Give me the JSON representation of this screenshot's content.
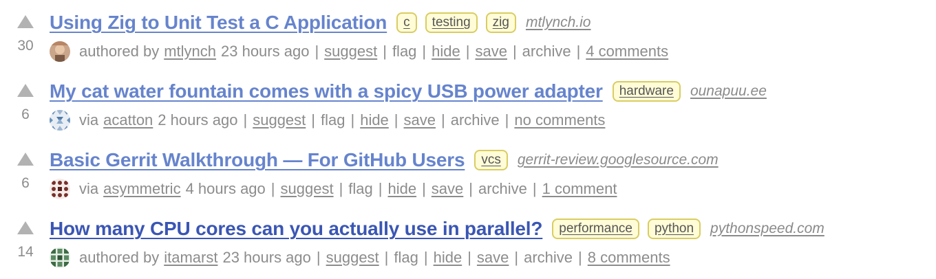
{
  "stories": [
    {
      "score": "30",
      "title": "Using Zig to Unit Test a C Application",
      "tags": [
        "c",
        "testing",
        "zig"
      ],
      "domain": "mtlynch.io",
      "attribution": "authored by",
      "user": "mtlynch",
      "time": "23 hours ago",
      "actions": {
        "suggest": "suggest",
        "flag": "flag",
        "hide": "hide",
        "save": "save",
        "archive": "archive"
      },
      "comments": "4 comments",
      "avatar_icon": "user-photo-avatar"
    },
    {
      "score": "6",
      "title": "My cat water fountain comes with a spicy USB power adapter",
      "tags": [
        "hardware"
      ],
      "domain": "ounapuu.ee",
      "attribution": "via",
      "user": "acatton",
      "time": "2 hours ago",
      "actions": {
        "suggest": "suggest",
        "flag": "flag",
        "hide": "hide",
        "save": "save",
        "archive": "archive"
      },
      "comments": "no comments",
      "avatar_icon": "blue-pattern-avatar"
    },
    {
      "score": "6",
      "title": "Basic Gerrit Walkthrough — For GitHub Users",
      "tags": [
        "vcs"
      ],
      "domain": "gerrit-review.googlesource.com",
      "attribution": "via",
      "user": "asymmetric",
      "time": "4 hours ago",
      "actions": {
        "suggest": "suggest",
        "flag": "flag",
        "hide": "hide",
        "save": "save",
        "archive": "archive"
      },
      "comments": "1 comment",
      "avatar_icon": "brown-pattern-avatar"
    },
    {
      "score": "14",
      "title": "How many CPU cores can you actually use in parallel?",
      "tags": [
        "performance",
        "python"
      ],
      "domain": "pythonspeed.com",
      "attribution": "authored by",
      "user": "itamarst",
      "time": "23 hours ago",
      "actions": {
        "suggest": "suggest",
        "flag": "flag",
        "hide": "hide",
        "save": "save",
        "archive": "archive"
      },
      "comments": "8 comments",
      "avatar_icon": "green-pattern-avatar"
    }
  ],
  "colors": {
    "title_link": "#6684cd",
    "title_link_dark": "#3a56b4",
    "tag_bg": "#fffcd7",
    "tag_border": "#d9cc62",
    "meta_text": "#8c8c8c",
    "upvote": "#b2b2b2"
  }
}
